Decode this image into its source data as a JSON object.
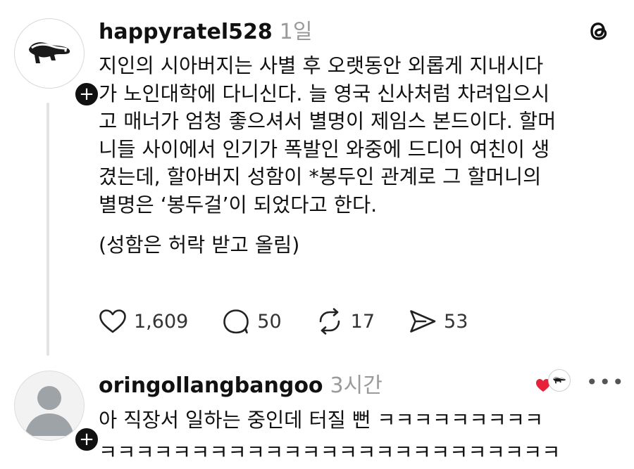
{
  "post": {
    "avatar_icon": "ratel-logo-avatar",
    "username": "happyratel528",
    "timestamp": "1일",
    "app_icon": "threads-logo-icon",
    "body_lines": [
      "지인의 시아버지는 사별 후 오랫동안 외롭게 지내시다",
      "가 노인대학에 다니신다. 늘 영국 신사처럼 차려입으시",
      "고 매너가 엄청 좋으셔서 별명이 제임스 본드이다. 할머",
      "니들 사이에서 인기가 폭발인 와중에 드디어 여친이 생",
      "겼는데, 할아버지 성함이 *봉두인 관계로 그 할머니의",
      "별명은 ‘봉두걸’이 되었다고 한다."
    ],
    "body_note": "(성함은 허락 받고 올림)",
    "actions": {
      "likes": "1,609",
      "replies": "50",
      "reposts": "17",
      "shares": "53"
    }
  },
  "reply": {
    "avatar_icon": "default-user-avatar",
    "username": "oringollangbangoo",
    "timestamp": "3시간",
    "text_lines": [
      "아 직장서 일하는 중인데 터질 뻔 ㅋㅋㅋㅋㅋㅋㅋㅋㅋ",
      "ㅋㅋㅋㅋㅋㅋㅋㅋㅋㅋㅋㅋㅋㅋㅋㅋㅋㅋㅋㅋㅋㅋㅋㅋㅋ"
    ],
    "more_label": "•••"
  },
  "colors": {
    "text": "#111111",
    "muted": "#9a9a9a",
    "heart_red": "#e8213a",
    "thread_line": "#e3e3e3"
  }
}
